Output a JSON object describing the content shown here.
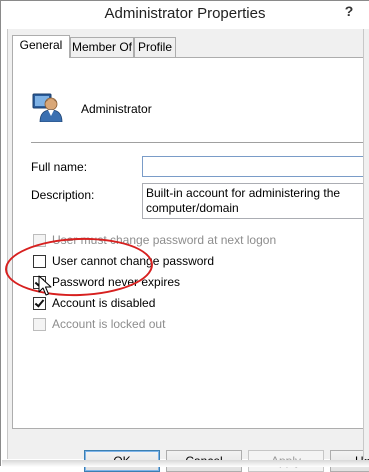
{
  "window": {
    "title": "Administrator Properties",
    "help_glyph": "?"
  },
  "tabs": [
    {
      "label": "General",
      "active": true
    },
    {
      "label": "Member Of",
      "active": false
    },
    {
      "label": "Profile",
      "active": false
    }
  ],
  "general": {
    "user_name": "Administrator",
    "user_icon": "user-account-icon",
    "full_name": {
      "label": "Full name:",
      "value": ""
    },
    "description": {
      "label": "Description:",
      "line1": "Built-in account for administering the",
      "line2": "computer/domain"
    },
    "checkboxes": [
      {
        "label": "User must change password at next logon",
        "checked": false,
        "enabled": false
      },
      {
        "label": "User cannot change password",
        "checked": false,
        "enabled": true
      },
      {
        "label": "Password never expires",
        "checked": true,
        "enabled": true
      },
      {
        "label": "Account is disabled",
        "checked": true,
        "enabled": true
      },
      {
        "label": "Account is locked out",
        "checked": false,
        "enabled": false
      }
    ]
  },
  "buttons": {
    "ok": "OK",
    "cancel": "Cancel",
    "apply": "Apply",
    "help": "He"
  },
  "colors": {
    "annotation": "#d7201f",
    "window_bg": "#f0f0f0"
  }
}
